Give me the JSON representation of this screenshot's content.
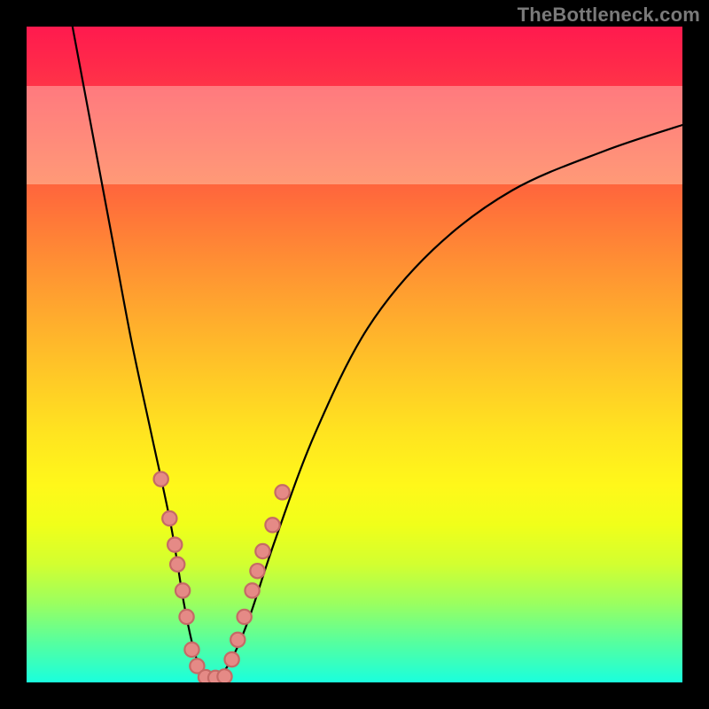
{
  "watermark": "TheBottleneck.com",
  "colors": {
    "frame": "#000000",
    "curve": "#000000",
    "dot_fill": "#e58a86",
    "dot_stroke": "#c56a66"
  },
  "chart_data": {
    "type": "line",
    "title": "",
    "xlabel": "",
    "ylabel": "",
    "xlim": [
      0,
      100
    ],
    "ylim": [
      0,
      100
    ],
    "grid": false,
    "legend": false,
    "annotations": [
      "TheBottleneck.com"
    ],
    "series": [
      {
        "name": "bottleneck-curve",
        "x": [
          7,
          10,
          13,
          16,
          19,
          22,
          24,
          25.5,
          27,
          28,
          29.5,
          31.5,
          34,
          38,
          44,
          52,
          62,
          74,
          88,
          100
        ],
        "y": [
          100,
          84,
          68,
          52,
          38,
          24,
          12,
          5,
          1,
          0.5,
          1,
          4,
          10,
          22,
          38,
          54,
          66,
          75,
          81,
          85
        ]
      }
    ],
    "points": [
      {
        "name": "left-cluster",
        "coords": [
          {
            "x": 20.5,
            "y": 31
          },
          {
            "x": 21.8,
            "y": 25
          },
          {
            "x": 22.6,
            "y": 21
          },
          {
            "x": 23.0,
            "y": 18
          },
          {
            "x": 23.8,
            "y": 14
          },
          {
            "x": 24.4,
            "y": 10
          },
          {
            "x": 25.2,
            "y": 5
          },
          {
            "x": 26.0,
            "y": 2.5
          }
        ]
      },
      {
        "name": "bottom-cluster",
        "coords": [
          {
            "x": 27.3,
            "y": 0.8
          },
          {
            "x": 28.8,
            "y": 0.7
          },
          {
            "x": 30.2,
            "y": 0.9
          }
        ]
      },
      {
        "name": "right-cluster",
        "coords": [
          {
            "x": 31.3,
            "y": 3.5
          },
          {
            "x": 32.2,
            "y": 6.5
          },
          {
            "x": 33.2,
            "y": 10
          },
          {
            "x": 34.4,
            "y": 14
          },
          {
            "x": 35.2,
            "y": 17
          },
          {
            "x": 36.0,
            "y": 20
          },
          {
            "x": 37.5,
            "y": 24
          },
          {
            "x": 39.0,
            "y": 29
          }
        ]
      }
    ],
    "pale_bands_y": [
      {
        "from": 76,
        "to": 91
      }
    ]
  }
}
